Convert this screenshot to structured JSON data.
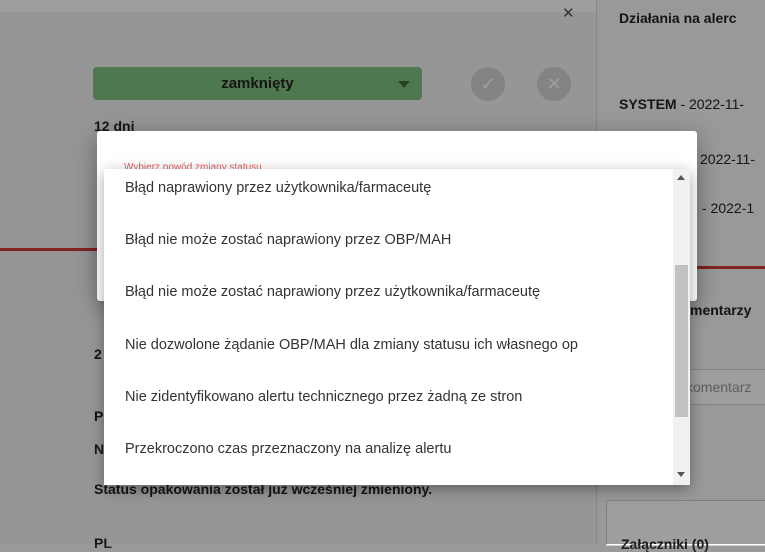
{
  "background": {
    "status_value": "zamknięty",
    "days": "12 dni",
    "right_heading": "Działania na alerc",
    "log_system": "SYSTEM",
    "log_date1": " - 2022-11-",
    "log_date2": "2022-11-",
    "log_date3": "- 2022-1",
    "comments_heading": "mentarzy",
    "comment_placeholder": "komentarz",
    "left_snippets": [
      "2",
      "P",
      "N"
    ],
    "status_line": "Status opakowania został już wcześniej zmieniony.",
    "pl_label": "PL",
    "attachments": "Załączniki (0)"
  },
  "dialog": {
    "label": "Wybierz powód zmiany statusu"
  },
  "dropdown": {
    "options": [
      "Błąd naprawiony przez użytkownika/farmaceutę",
      "Błąd nie może zostać naprawiony przez OBP/MAH",
      "Błąd nie może zostać naprawiony przez użytkownika/farmaceutę",
      "Nie dozwolone żądanie OBP/MAH dla zmiany statusu ich własnego op",
      "Nie zidentyfikowano alertu technicznego przez żadną ze stron",
      "Przekroczono czas przeznaczony na analizę alertu"
    ]
  },
  "colors": {
    "status_green": "#7fc47f",
    "accent_red": "#d23b3b",
    "label_red": "#e35d5d"
  }
}
